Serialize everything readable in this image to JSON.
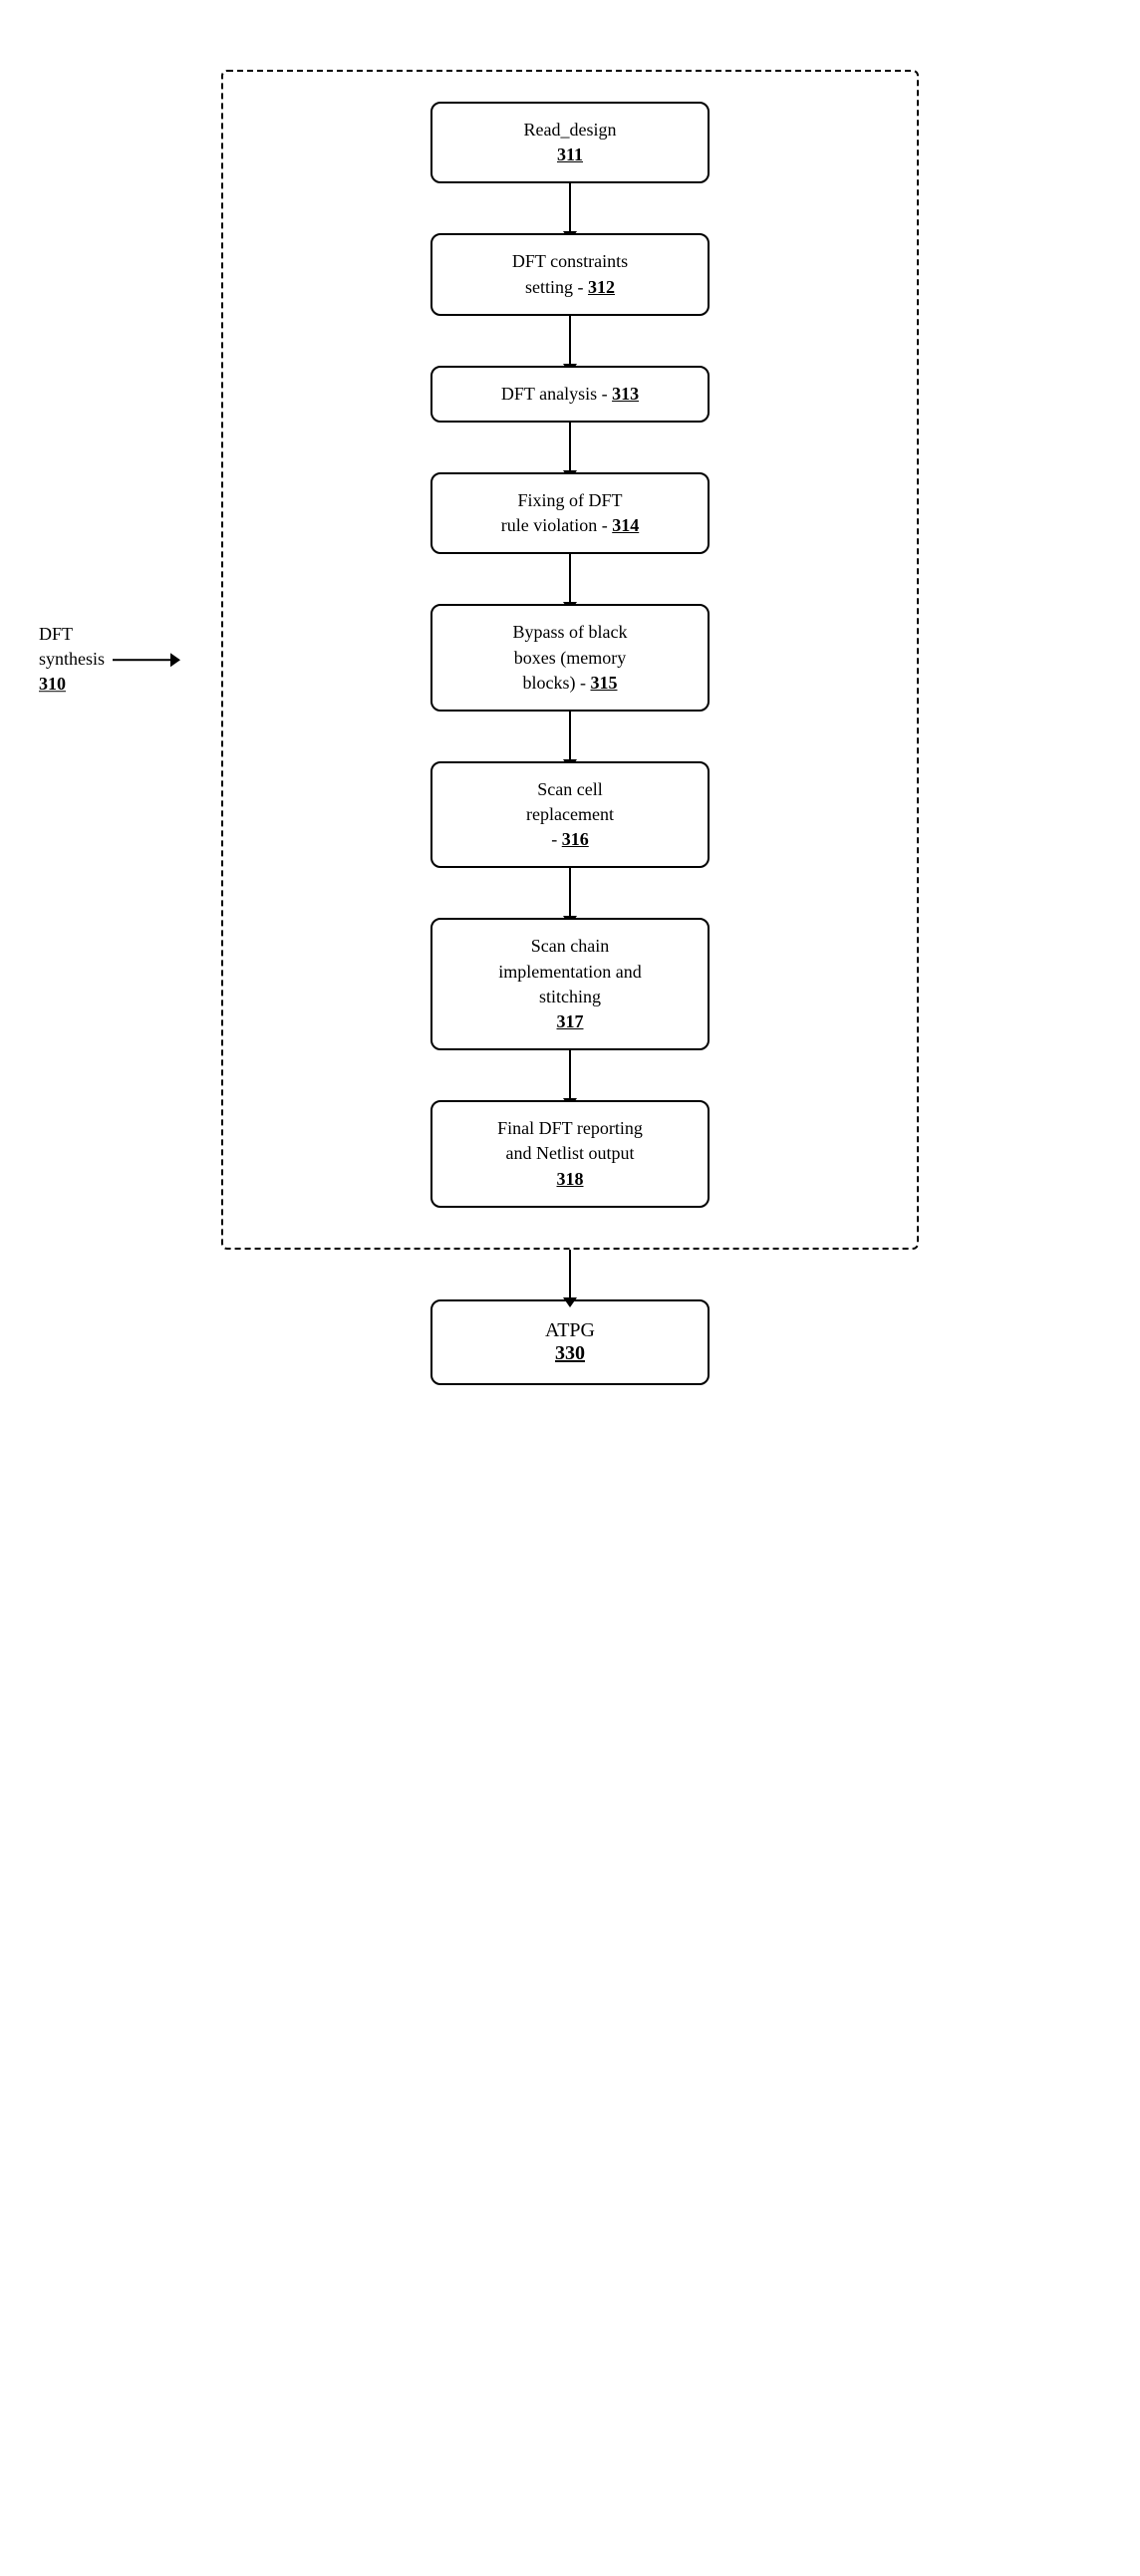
{
  "diagram": {
    "dft_synthesis_label": "DFT\nsynthesis",
    "dft_synthesis_number": "310",
    "boxes": [
      {
        "id": "box-311",
        "line1": "Read_design",
        "line2": "",
        "number": "311"
      },
      {
        "id": "box-312",
        "line1": "DFT constraints",
        "line2": "setting - ",
        "number": "312"
      },
      {
        "id": "box-313",
        "line1": "DFT analysis - ",
        "line2": "",
        "number": "313"
      },
      {
        "id": "box-314",
        "line1": "Fixing of DFT",
        "line2": "rule violation - ",
        "number": "314"
      },
      {
        "id": "box-315",
        "line1": "Bypass of black",
        "line2": "boxes (memory",
        "line3": "blocks) - ",
        "number": "315"
      },
      {
        "id": "box-316",
        "line1": "Scan cell",
        "line2": "replacement",
        "line3": "- ",
        "number": "316"
      },
      {
        "id": "box-317",
        "line1": "Scan chain",
        "line2": "implementation and",
        "line3": "stitching",
        "number": "317"
      },
      {
        "id": "box-318",
        "line1": "Final DFT reporting",
        "line2": "and Netlist output",
        "number": "318"
      }
    ],
    "atpg": {
      "label": "ATPG",
      "number": "330"
    }
  }
}
